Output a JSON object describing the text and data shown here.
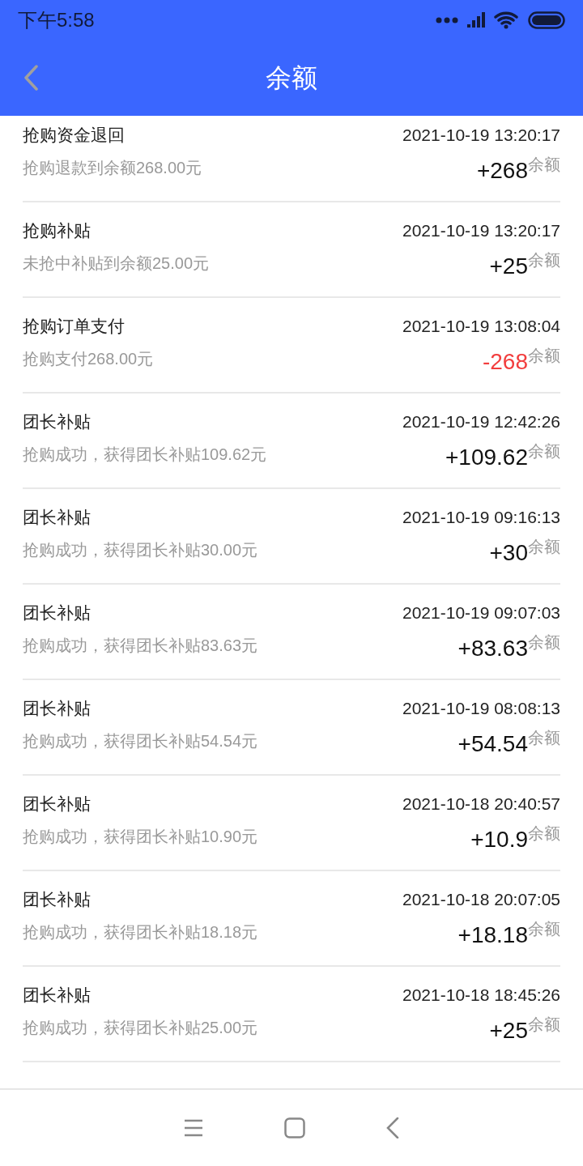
{
  "status_bar": {
    "time": "下午5:58"
  },
  "header": {
    "title": "余额"
  },
  "records": [
    {
      "title": "抢购资金退回",
      "time": "2021-10-19 13:20:17",
      "description": "抢购退款到余额268.00元",
      "amount": "+268",
      "unit": "余额",
      "kind": "income"
    },
    {
      "title": "抢购补贴",
      "time": "2021-10-19 13:20:17",
      "description": "未抢中补贴到余额25.00元",
      "amount": "+25",
      "unit": "余额",
      "kind": "income"
    },
    {
      "title": "抢购订单支付",
      "time": "2021-10-19 13:08:04",
      "description": "抢购支付268.00元",
      "amount": "-268",
      "unit": "余额",
      "kind": "expense"
    },
    {
      "title": "团长补贴",
      "time": "2021-10-19 12:42:26",
      "description": "抢购成功，获得团长补贴109.62元",
      "amount": "+109.62",
      "unit": "余额",
      "kind": "income"
    },
    {
      "title": "团长补贴",
      "time": "2021-10-19 09:16:13",
      "description": "抢购成功，获得团长补贴30.00元",
      "amount": "+30",
      "unit": "余额",
      "kind": "income"
    },
    {
      "title": "团长补贴",
      "time": "2021-10-19 09:07:03",
      "description": "抢购成功，获得团长补贴83.63元",
      "amount": "+83.63",
      "unit": "余额",
      "kind": "income"
    },
    {
      "title": "团长补贴",
      "time": "2021-10-19 08:08:13",
      "description": "抢购成功，获得团长补贴54.54元",
      "amount": "+54.54",
      "unit": "余额",
      "kind": "income"
    },
    {
      "title": "团长补贴",
      "time": "2021-10-18 20:40:57",
      "description": "抢购成功，获得团长补贴10.90元",
      "amount": "+10.9",
      "unit": "余额",
      "kind": "income"
    },
    {
      "title": "团长补贴",
      "time": "2021-10-18 20:07:05",
      "description": "抢购成功，获得团长补贴18.18元",
      "amount": "+18.18",
      "unit": "余额",
      "kind": "income"
    },
    {
      "title": "团长补贴",
      "time": "2021-10-18 18:45:26",
      "description": "抢购成功，获得团长补贴25.00元",
      "amount": "+25",
      "unit": "余额",
      "kind": "income"
    }
  ]
}
